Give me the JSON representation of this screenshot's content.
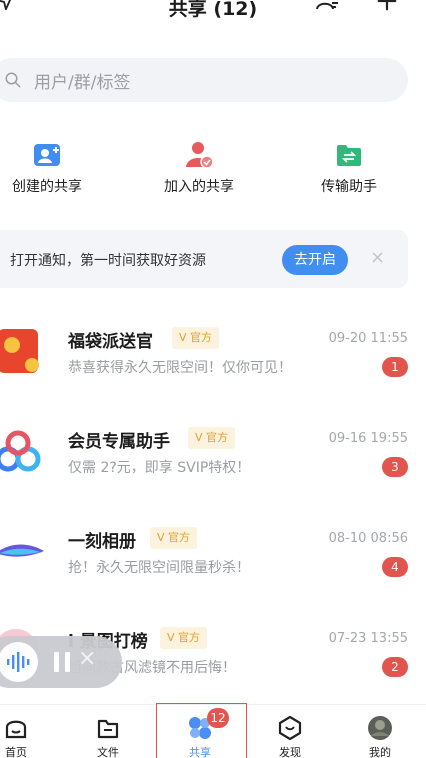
{
  "header": {
    "title": "共享 (12)"
  },
  "search": {
    "placeholder": "用户/群/标签"
  },
  "quick_actions": [
    {
      "label": "创建的共享",
      "icon": "user-add-icon"
    },
    {
      "label": "加入的共享",
      "icon": "group-joined-icon"
    },
    {
      "label": "传输助手",
      "icon": "transfer-folder-icon"
    }
  ],
  "notice": {
    "text": "打开通知，第一时间获取好资源",
    "button": "去开启",
    "close": "×"
  },
  "conversations": [
    {
      "name": "福袋派送官",
      "tag": "V 官方",
      "time": "09-20 11:55",
      "message": "恭喜获得永久无限空间！仅你可见！",
      "unread": "1"
    },
    {
      "name": "会员专属助手",
      "tag": "V 官方",
      "time": "09-16 19:55",
      "message": "仅需 2?元，即享 SVIP特权！",
      "unread": "3"
    },
    {
      "name": "一刻相册",
      "tag": "V 官方",
      "time": "08-10 08:56",
      "message": "抢！永久无限空间限量秒杀！",
      "unread": "4"
    },
    {
      "name": "i 景图打榜",
      "tag": "V 官方",
      "time": "07-23 13:55",
      "message": "组同款古风滤镜不用后悔！",
      "unread": "2"
    }
  ],
  "tabbar": {
    "items": [
      {
        "label": "首页",
        "icon": "home-icon"
      },
      {
        "label": "文件",
        "icon": "folder-icon"
      },
      {
        "label": "共享",
        "icon": "share-icon"
      },
      {
        "label": "发现",
        "icon": "discover-icon"
      },
      {
        "label": "我的",
        "icon": "profile-avatar-icon"
      }
    ],
    "share_badge": "12"
  },
  "colors": {
    "accent": "#3f8ef0",
    "badge": "#e2544e",
    "tag_text": "#e2a12d",
    "tag_bg": "#fbf3dd"
  }
}
